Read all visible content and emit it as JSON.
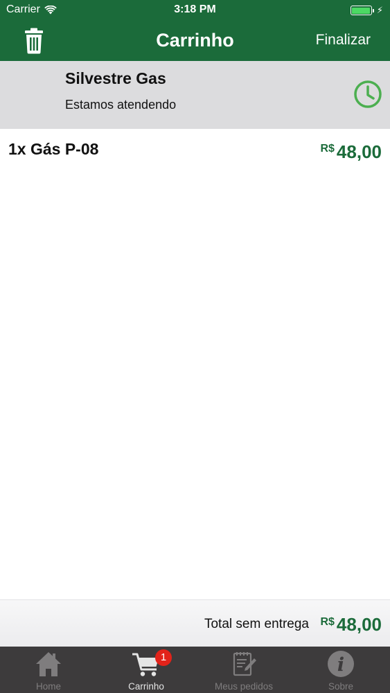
{
  "status_bar": {
    "carrier": "Carrier",
    "time": "3:18 PM",
    "battery_level": 1.0
  },
  "nav": {
    "title": "Carrinho",
    "finalize_label": "Finalizar"
  },
  "store": {
    "name": "Silvestre Gas",
    "status": "Estamos atendendo"
  },
  "cart": {
    "items": [
      {
        "label": "1x Gás P-08",
        "currency": "R$",
        "price": "48,00"
      }
    ]
  },
  "total": {
    "label": "Total sem entrega",
    "currency": "R$",
    "value": "48,00"
  },
  "tabs": [
    {
      "label": "Home",
      "icon": "home-icon",
      "active": false
    },
    {
      "label": "Carrinho",
      "icon": "cart-icon",
      "active": true,
      "badge": "1"
    },
    {
      "label": "Meus pedidos",
      "icon": "orders-icon",
      "active": false
    },
    {
      "label": "Sobre",
      "icon": "info-icon",
      "active": false
    }
  ],
  "colors": {
    "brand_green": "#1b6b3a",
    "clock_green": "#4caf50",
    "badge_red": "#e2231a",
    "tab_bar": "#3d3b3c"
  }
}
